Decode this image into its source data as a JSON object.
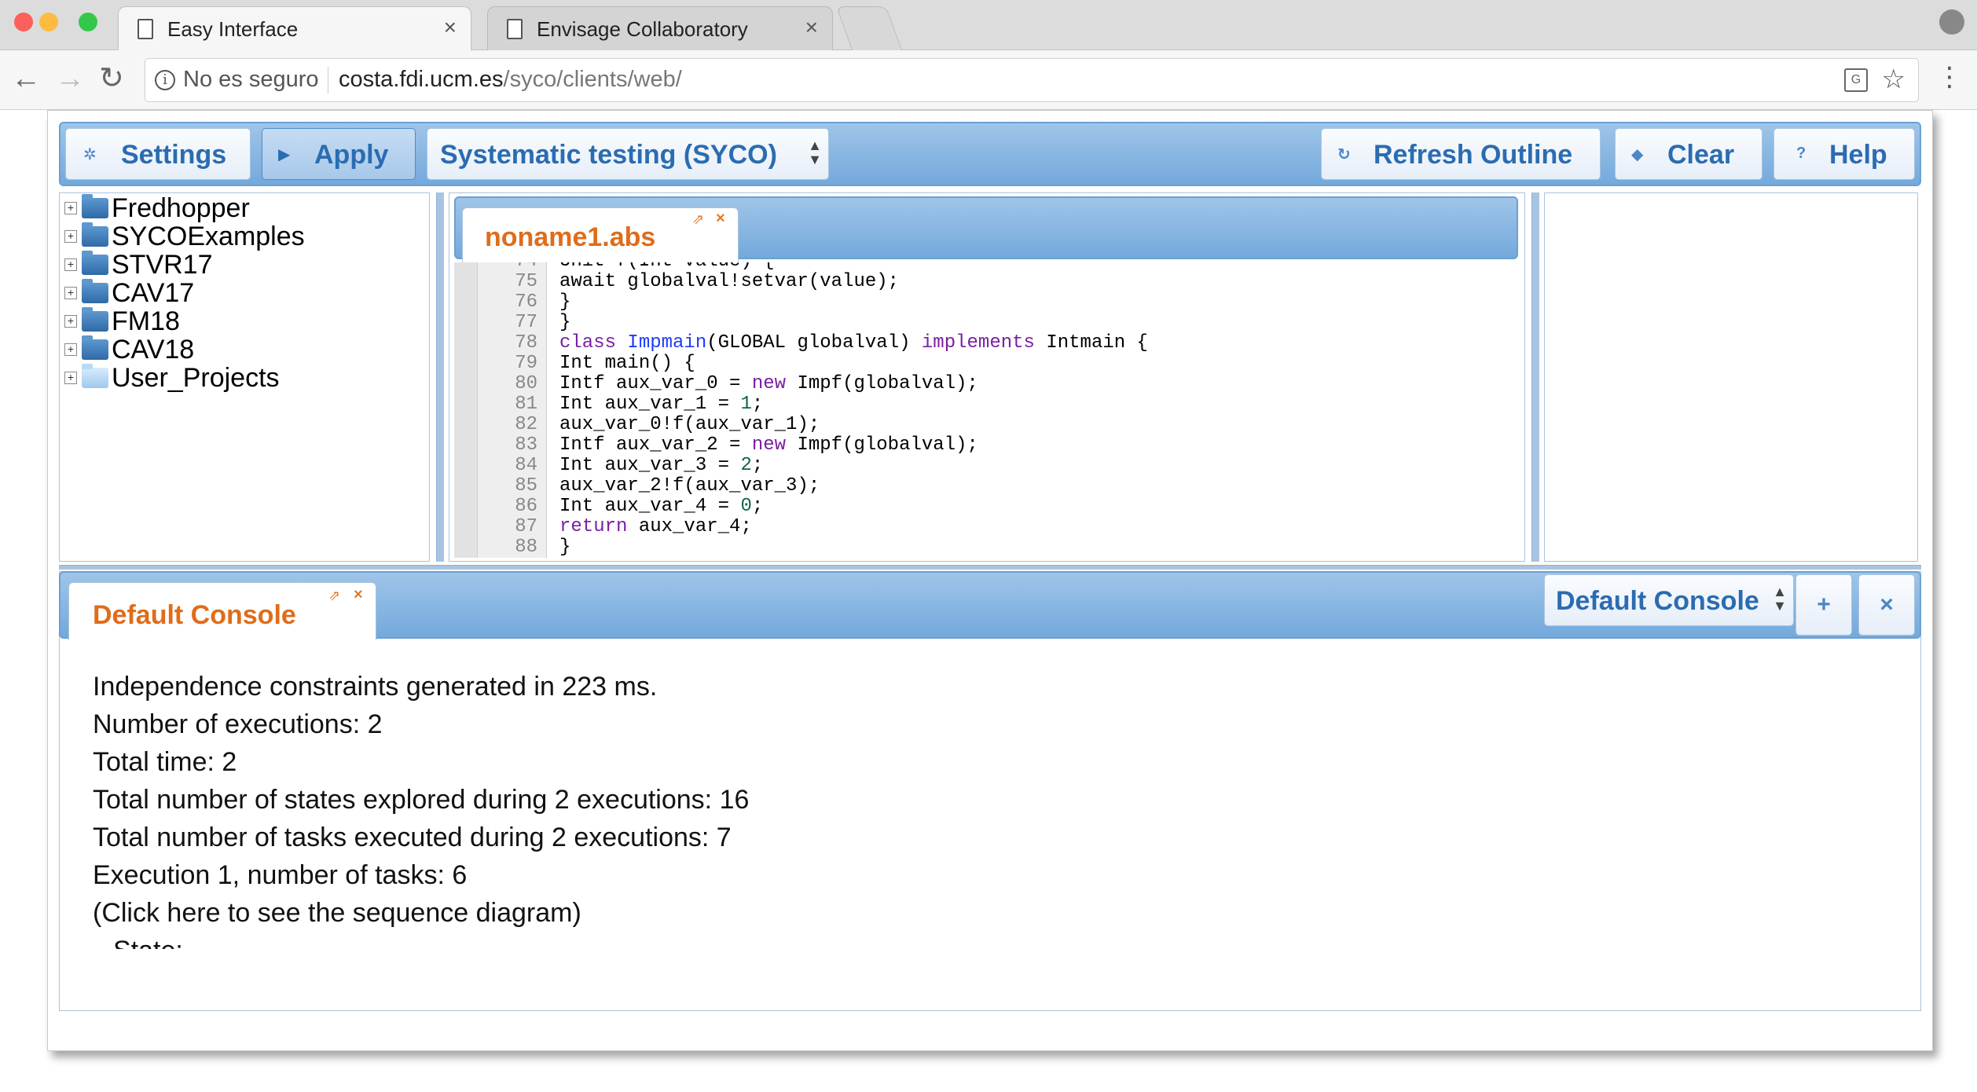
{
  "browser": {
    "tabs": [
      {
        "label": "Easy Interface",
        "active": true
      },
      {
        "label": "Envisage Collaboratory",
        "active": false
      }
    ],
    "security_label": "No es seguro",
    "url_host": "costa.fdi.ucm.es",
    "url_path": "/syco/clients/web/",
    "traffic_lights": [
      "#fc605c",
      "#fdbc40",
      "#34c84a"
    ]
  },
  "toolbar": {
    "settings_label": "Settings",
    "apply_label": "Apply",
    "tool_select": "Systematic testing (SYCO)",
    "refresh_label": "Refresh Outline",
    "clear_label": "Clear",
    "help_label": "Help"
  },
  "tree": {
    "items": [
      {
        "label": "Fredhopper",
        "icon": "folder-icon"
      },
      {
        "label": "SYCOExamples",
        "icon": "folder-icon"
      },
      {
        "label": "STVR17",
        "icon": "folder-icon"
      },
      {
        "label": "CAV17",
        "icon": "folder-icon"
      },
      {
        "label": "FM18",
        "icon": "folder-icon"
      },
      {
        "label": "CAV18",
        "icon": "folder-icon"
      },
      {
        "label": "User_Projects",
        "icon": "folder-icon"
      }
    ]
  },
  "editor": {
    "tab_label": "noname1.abs",
    "partial_top_line": "Unit f(Int value) {",
    "lines": [
      {
        "num": "75",
        "text": "await globalval!setvar(value);"
      },
      {
        "num": "76",
        "text": "}"
      },
      {
        "num": "77",
        "text": "}"
      },
      {
        "num": "78",
        "text": "class Impmain(GLOBAL globalval) implements Intmain {"
      },
      {
        "num": "79",
        "text": "Int main() {"
      },
      {
        "num": "80",
        "text": "Intf aux_var_0 = new Impf(globalval);"
      },
      {
        "num": "81",
        "text": "Int aux_var_1 = 1;"
      },
      {
        "num": "82",
        "text": "aux_var_0!f(aux_var_1);"
      },
      {
        "num": "83",
        "text": "Intf aux_var_2 = new Impf(globalval);"
      },
      {
        "num": "84",
        "text": "Int aux_var_3 = 2;"
      },
      {
        "num": "85",
        "text": "aux_var_2!f(aux_var_3);"
      },
      {
        "num": "86",
        "text": "Int aux_var_4 = 0;"
      },
      {
        "num": "87",
        "text": "return aux_var_4;"
      },
      {
        "num": "88",
        "text": "}"
      }
    ]
  },
  "console": {
    "tab_label": "Default Console",
    "select_label": "Default Console",
    "add_label": "+",
    "close_label": "×",
    "lines": [
      "Independence constraints generated in 223 ms.",
      "Number of executions: 2",
      "Total time: 2",
      "Total number of states explored during 2 executions: 16",
      "Total number of tasks executed during 2 executions: 7",
      "Execution 1, number of tasks: 6",
      "(Click here to see the sequence diagram)",
      "State:"
    ]
  }
}
